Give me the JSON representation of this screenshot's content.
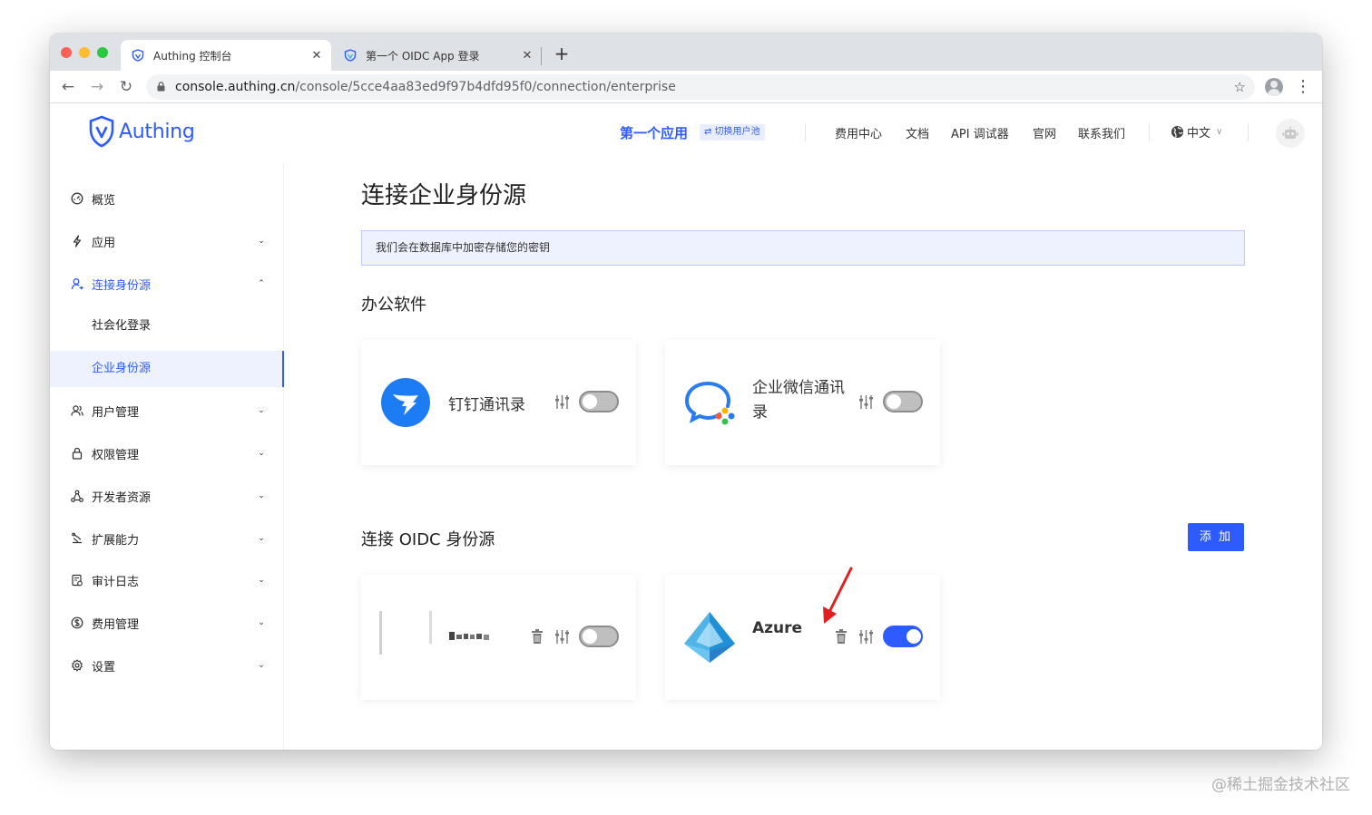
{
  "browser": {
    "tabs": [
      {
        "title": "Authing 控制台",
        "close": "✕"
      },
      {
        "title": "第一个 OIDC App 登录",
        "close": "✕"
      }
    ],
    "new_tab": "+",
    "back": "←",
    "forward": "→",
    "reload": "↻",
    "address": {
      "host": "console.authing.cn",
      "path": "/console/5cce4aa83ed9f97b4dfd95f0/connection/enterprise"
    },
    "star": "☆",
    "menu": "⋮"
  },
  "header": {
    "logo_text": "Authing",
    "current_app": "第一个应用",
    "switch_pool": "⇄ 切换用户池",
    "nav": [
      "费用中心",
      "文档",
      "API 调试器",
      "官网",
      "联系我们"
    ],
    "language": "中文",
    "language_chevron": "∨"
  },
  "sidebar": {
    "caret_down": "⌄",
    "caret_up": "⌃",
    "items": [
      {
        "label": "概览",
        "icon": "dashboard-icon"
      },
      {
        "label": "应用",
        "icon": "lightning-icon"
      },
      {
        "label": "连接身份源",
        "icon": "user-link-icon"
      },
      {
        "label": "用户管理",
        "icon": "users-icon"
      },
      {
        "label": "权限管理",
        "icon": "lock-icon"
      },
      {
        "label": "开发者资源",
        "icon": "nodes-icon"
      },
      {
        "label": "扩展能力",
        "icon": "extension-icon"
      },
      {
        "label": "审计日志",
        "icon": "log-icon"
      },
      {
        "label": "费用管理",
        "icon": "dollar-icon"
      },
      {
        "label": "设置",
        "icon": "gear-icon"
      }
    ],
    "sub_items": [
      "社会化登录",
      "企业身份源"
    ]
  },
  "main": {
    "title": "连接企业身份源",
    "notice": "我们会在数据库中加密存储您的密钥",
    "office_section": "办公软件",
    "oidc_section": "连接 OIDC 身份源",
    "add_button": "添 加",
    "office_cards": [
      {
        "name": "钉钉通讯录",
        "enabled": false
      },
      {
        "name": "企业微信通讯录",
        "enabled": false
      }
    ],
    "oidc_cards": [
      {
        "name": "",
        "enabled": false
      },
      {
        "name": "Azure",
        "enabled": true
      }
    ]
  },
  "colors": {
    "accent": "#2e5bff",
    "dingtalk": "#1b7cf4"
  },
  "watermark": "@稀土掘金技术社区"
}
